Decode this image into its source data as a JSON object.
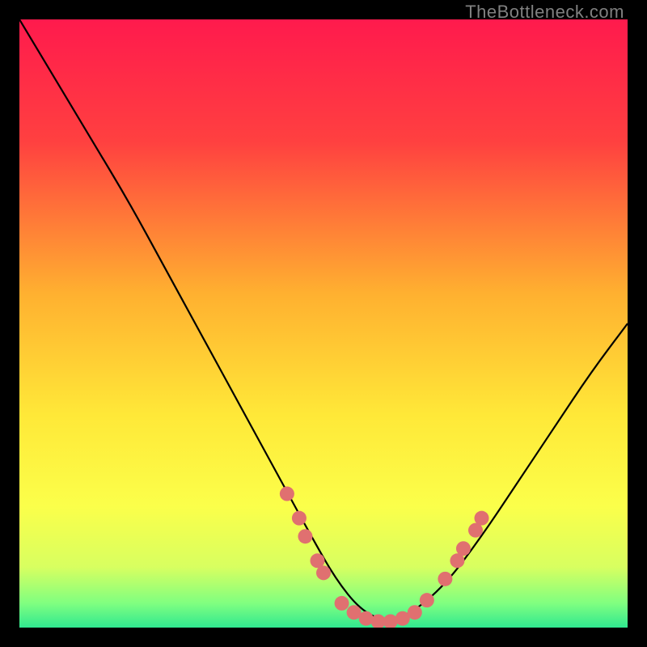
{
  "watermark": "TheBottleneck.com",
  "chart_data": {
    "type": "line",
    "title": "",
    "xlabel": "",
    "ylabel": "",
    "xlim": [
      0,
      100
    ],
    "ylim": [
      0,
      100
    ],
    "grid": false,
    "legend": false,
    "series": [
      {
        "name": "bottleneck-curve",
        "x": [
          0,
          6,
          12,
          18,
          24,
          30,
          36,
          42,
          48,
          52,
          56,
          60,
          64,
          70,
          76,
          82,
          88,
          94,
          100
        ],
        "y": [
          100,
          90,
          80,
          70,
          59,
          48,
          37,
          26,
          15,
          8,
          3,
          1,
          2,
          7,
          15,
          24,
          33,
          42,
          50
        ]
      }
    ],
    "markers": {
      "name": "highlight-dots",
      "color": "#e07070",
      "points": [
        {
          "x": 44,
          "y": 22
        },
        {
          "x": 46,
          "y": 18
        },
        {
          "x": 47,
          "y": 15
        },
        {
          "x": 49,
          "y": 11
        },
        {
          "x": 50,
          "y": 9
        },
        {
          "x": 53,
          "y": 4
        },
        {
          "x": 55,
          "y": 2.5
        },
        {
          "x": 57,
          "y": 1.5
        },
        {
          "x": 59,
          "y": 1
        },
        {
          "x": 61,
          "y": 1
        },
        {
          "x": 63,
          "y": 1.5
        },
        {
          "x": 65,
          "y": 2.5
        },
        {
          "x": 67,
          "y": 4.5
        },
        {
          "x": 70,
          "y": 8
        },
        {
          "x": 72,
          "y": 11
        },
        {
          "x": 73,
          "y": 13
        },
        {
          "x": 75,
          "y": 16
        },
        {
          "x": 76,
          "y": 18
        }
      ]
    },
    "gradient_stops": [
      {
        "offset": 0.0,
        "color": "#ff1a4d"
      },
      {
        "offset": 0.2,
        "color": "#ff4040"
      },
      {
        "offset": 0.45,
        "color": "#ffb030"
      },
      {
        "offset": 0.65,
        "color": "#ffe838"
      },
      {
        "offset": 0.8,
        "color": "#fbff4a"
      },
      {
        "offset": 0.9,
        "color": "#d8ff60"
      },
      {
        "offset": 0.96,
        "color": "#80ff80"
      },
      {
        "offset": 1.0,
        "color": "#30e890"
      }
    ]
  }
}
